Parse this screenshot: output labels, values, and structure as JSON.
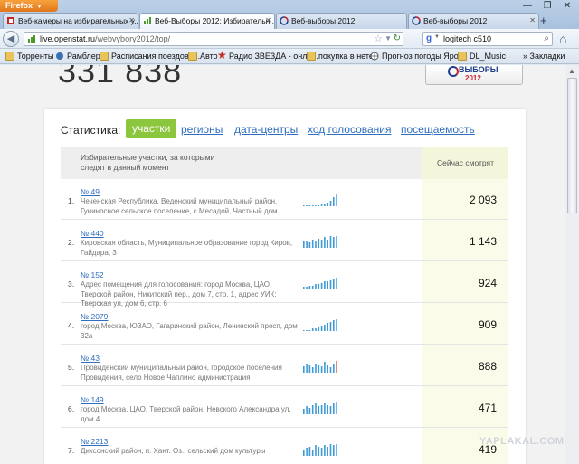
{
  "browser": {
    "app_menu": "Firefox",
    "tabs": [
      {
        "title": "Веб-камеры на избирательных у...",
        "active": false
      },
      {
        "title": "Веб-Выборы 2012: Избирательн...",
        "active": true
      },
      {
        "title": "Веб-выборы 2012",
        "active": false
      },
      {
        "title": "Веб-выборы 2012",
        "active": false
      }
    ],
    "new_tab": "+",
    "url_host": "live.openstat.ru",
    "url_path": "/webvybory2012/top/",
    "search_value": "logitech c510",
    "search_engine": "g",
    "bookmarks": [
      {
        "label": "Торренты",
        "icon": "folder-icon"
      },
      {
        "label": "Рамблер",
        "icon": "rambler-icon"
      },
      {
        "label": "Расписания поездов, ...",
        "icon": "folder-icon"
      },
      {
        "label": "Авто",
        "icon": "folder-icon"
      },
      {
        "label": "Радио ЗВЕЗДА - онла...",
        "icon": "star-icon"
      },
      {
        "label": "покупка в нете",
        "icon": "folder-icon"
      },
      {
        "label": "Прогноз погоды Яро...",
        "icon": "globe-icon"
      },
      {
        "label": "DL_Music",
        "icon": "folder-icon"
      }
    ],
    "bookmarks_menu": "» Закладки"
  },
  "page": {
    "total": "331 838",
    "logo_line1": "ВЫБОРЫ",
    "logo_line2": "2012",
    "stats_label": "Статистика:",
    "nav": {
      "active": "участки",
      "links": [
        "регионы",
        "дата-центры",
        "ход голосования",
        "посещаемость"
      ]
    },
    "table": {
      "col1_header": "Избирательные участки, за которыми следят в данный момент",
      "col2_header": "Сейчас смотрят",
      "rows": [
        {
          "rank": "1.",
          "id": "№ 49",
          "address": "Чеченская Республика, Веденский муниципальный район, Гуниносное сельское поселение, с.Месадой, Частный дом",
          "count": "2 093",
          "trend": [
            1,
            1,
            1,
            1,
            1,
            1,
            2,
            2,
            3,
            4,
            7,
            9
          ],
          "peak": false
        },
        {
          "rank": "2.",
          "id": "№ 440",
          "address": "Кировская область, Муниципальное образование город Киров, Гайдара, 3",
          "count": "1 143",
          "trend": [
            5,
            5,
            4,
            6,
            5,
            7,
            6,
            8,
            6,
            9,
            8,
            9
          ],
          "peak": false
        },
        {
          "rank": "3.",
          "id": "№ 152",
          "address": "Адрес помещения для голосования: город Москва, ЦАО, Тверской район, Никитский пер., дом 7, стр. 1, адрес УИК: Тверская ул, дом 6, стр. 6",
          "count": "924",
          "trend": [
            2,
            2,
            3,
            3,
            4,
            4,
            5,
            6,
            6,
            7,
            8,
            9
          ],
          "peak": false
        },
        {
          "rank": "4.",
          "id": "№ 2079",
          "address": "город Москва, ЮЗАО, Гагаринский район, Ленинский просп, дом 32а",
          "count": "909",
          "trend": [
            1,
            1,
            1,
            2,
            2,
            3,
            4,
            5,
            6,
            7,
            8,
            9
          ],
          "peak": false
        },
        {
          "rank": "5.",
          "id": "№ 43",
          "address": "Провиденский муниципальный район, городское поселения Провидения, село Новое Чаплино администрация",
          "count": "888",
          "trend": [
            5,
            7,
            6,
            4,
            7,
            6,
            5,
            8,
            6,
            4,
            7,
            9
          ],
          "peak": true
        },
        {
          "rank": "6.",
          "id": "№ 149",
          "address": "город Москва, ЦАО, Тверской район, Невского Александра ул, дом 4",
          "count": "471",
          "trend": [
            4,
            6,
            5,
            7,
            8,
            6,
            7,
            8,
            7,
            6,
            8,
            9
          ],
          "peak": false
        },
        {
          "rank": "7.",
          "id": "№ 2213",
          "address": "Диксонский район, п. Хант. Оз., сельский дом культуры",
          "count": "419",
          "trend": [
            4,
            6,
            7,
            5,
            8,
            7,
            6,
            8,
            7,
            9,
            8,
            9
          ],
          "peak": false
        }
      ]
    }
  },
  "watermark": "YAPLAKAL.COM",
  "colors": {
    "accent_green": "#8cc63f",
    "link_blue": "#2f6ec0",
    "spark_blue": "#3d9ad6",
    "spark_peak": "#d9534f"
  }
}
